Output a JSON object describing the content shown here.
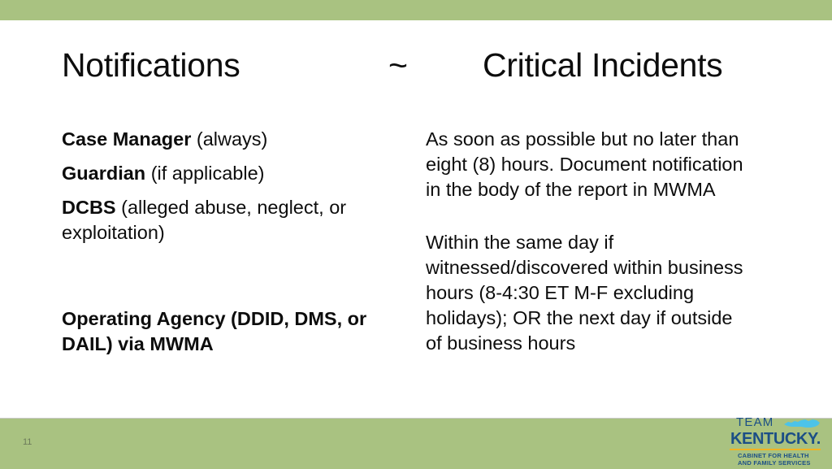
{
  "slide": {
    "page_number": "11",
    "accent_color": "#a9c281",
    "text_color": "#0d0d0d",
    "background_color": "#ffffff"
  },
  "title": {
    "left": "Notifications",
    "separator": "~",
    "right": "Critical Incidents"
  },
  "left_column": {
    "items": [
      {
        "bold": "Case Manager",
        "rest": " (always)"
      },
      {
        "bold": "Guardian",
        "rest": " (if applicable)"
      },
      {
        "bold": "DCBS",
        "rest": " (alleged abuse, neglect, or exploitation)"
      }
    ],
    "second_block": "Operating Agency (DDID, DMS, or DAIL) via MWMA"
  },
  "right_column": {
    "paragraph_1": "As soon as possible but no later than eight (8) hours. Document notification in the body of the report in MWMA",
    "paragraph_2": "Within the same day  if witnessed/discovered within business hours (8-4:30 ET M-F excluding holidays); OR the next day if outside of business hours"
  },
  "logo": {
    "team": "TEAM",
    "kentucky": "KENTUCKY.",
    "tagline_line_1": "CABINET FOR HEALTH",
    "tagline_line_2": "AND FAMILY SERVICES",
    "brand_blue": "#1c4f86",
    "state_blue": "#4cc3e8",
    "rule_gold": "#f0b323"
  }
}
